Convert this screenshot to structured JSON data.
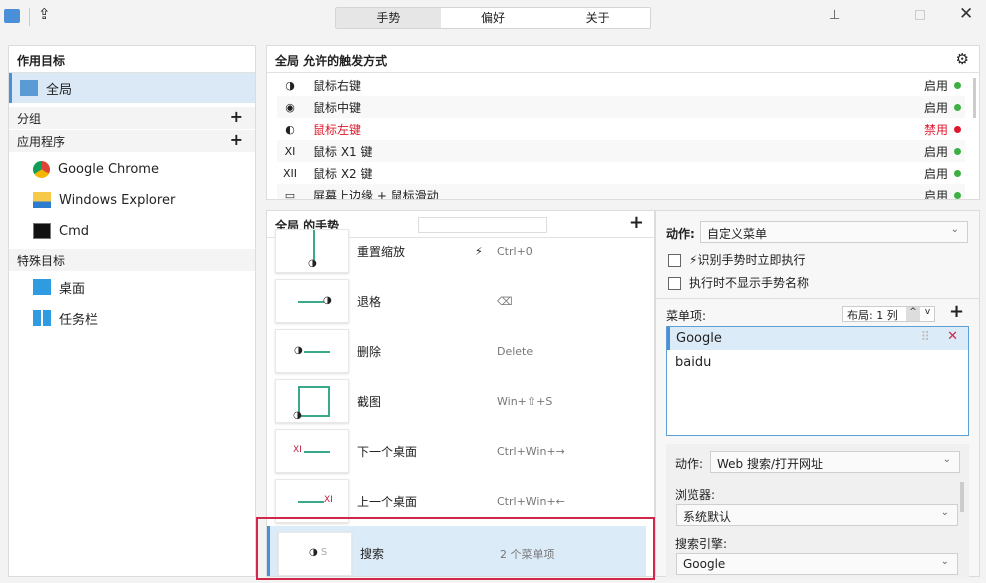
{
  "toolbar": {
    "tabs": [
      "手势",
      "偏好",
      "关于"
    ]
  },
  "targets": {
    "title": "作用目标",
    "global": "全局",
    "groups": "分组",
    "apps_label": "应用程序",
    "apps": [
      "Google Chrome",
      "Windows Explorer",
      "Cmd"
    ],
    "special": "特殊目标",
    "special_items": [
      "桌面",
      "任务栏"
    ]
  },
  "triggers": {
    "title": "全局 允许的触发方式",
    "rows": [
      {
        "icon": "◑",
        "label": "鼠标右键",
        "status": "启用",
        "color": "#3cb043"
      },
      {
        "icon": "◉",
        "label": "鼠标中键",
        "status": "启用",
        "color": "#3cb043"
      },
      {
        "icon": "◐",
        "label": "鼠标左键",
        "status": "禁用",
        "color": "#e0182d"
      },
      {
        "icon": "XI",
        "label": "鼠标 X1 键",
        "status": "启用",
        "color": "#3cb043"
      },
      {
        "icon": "XII",
        "label": "鼠标 X2 键",
        "status": "启用",
        "color": "#3cb043"
      },
      {
        "icon": "▭",
        "label": "屏幕上边缘 + 鼠标滑动",
        "status": "启用",
        "color": "#3cb043"
      }
    ]
  },
  "gestures": {
    "title": "全局 的手势",
    "rows": [
      {
        "name": "重置缩放",
        "key": "Ctrl+0",
        "instant": "⚡"
      },
      {
        "name": "退格",
        "key": "⌫"
      },
      {
        "name": "删除",
        "key": "Delete"
      },
      {
        "name": "截图",
        "key": "Win+⇧+S"
      },
      {
        "name": "下一个桌面",
        "key": "Ctrl+Win+→"
      },
      {
        "name": "上一个桌面",
        "key": "Ctrl+Win+←"
      },
      {
        "name": "搜索",
        "key": "2 个菜单项"
      }
    ]
  },
  "detail": {
    "action_label": "动作:",
    "action_value": "自定义菜单",
    "cb1": "识别手势时立即执行",
    "cb2": "执行时不显示手势名称",
    "menu_label": "菜单项:",
    "layout": "布局: 1 列",
    "menu_items": [
      "Google",
      "baidu"
    ],
    "sub_action_label": "动作:",
    "sub_action_value": "Web 搜索/打开网址",
    "browser_label": "浏览器:",
    "browser_value": "系统默认",
    "engine_label": "搜索引擎:",
    "engine_value": "Google"
  }
}
